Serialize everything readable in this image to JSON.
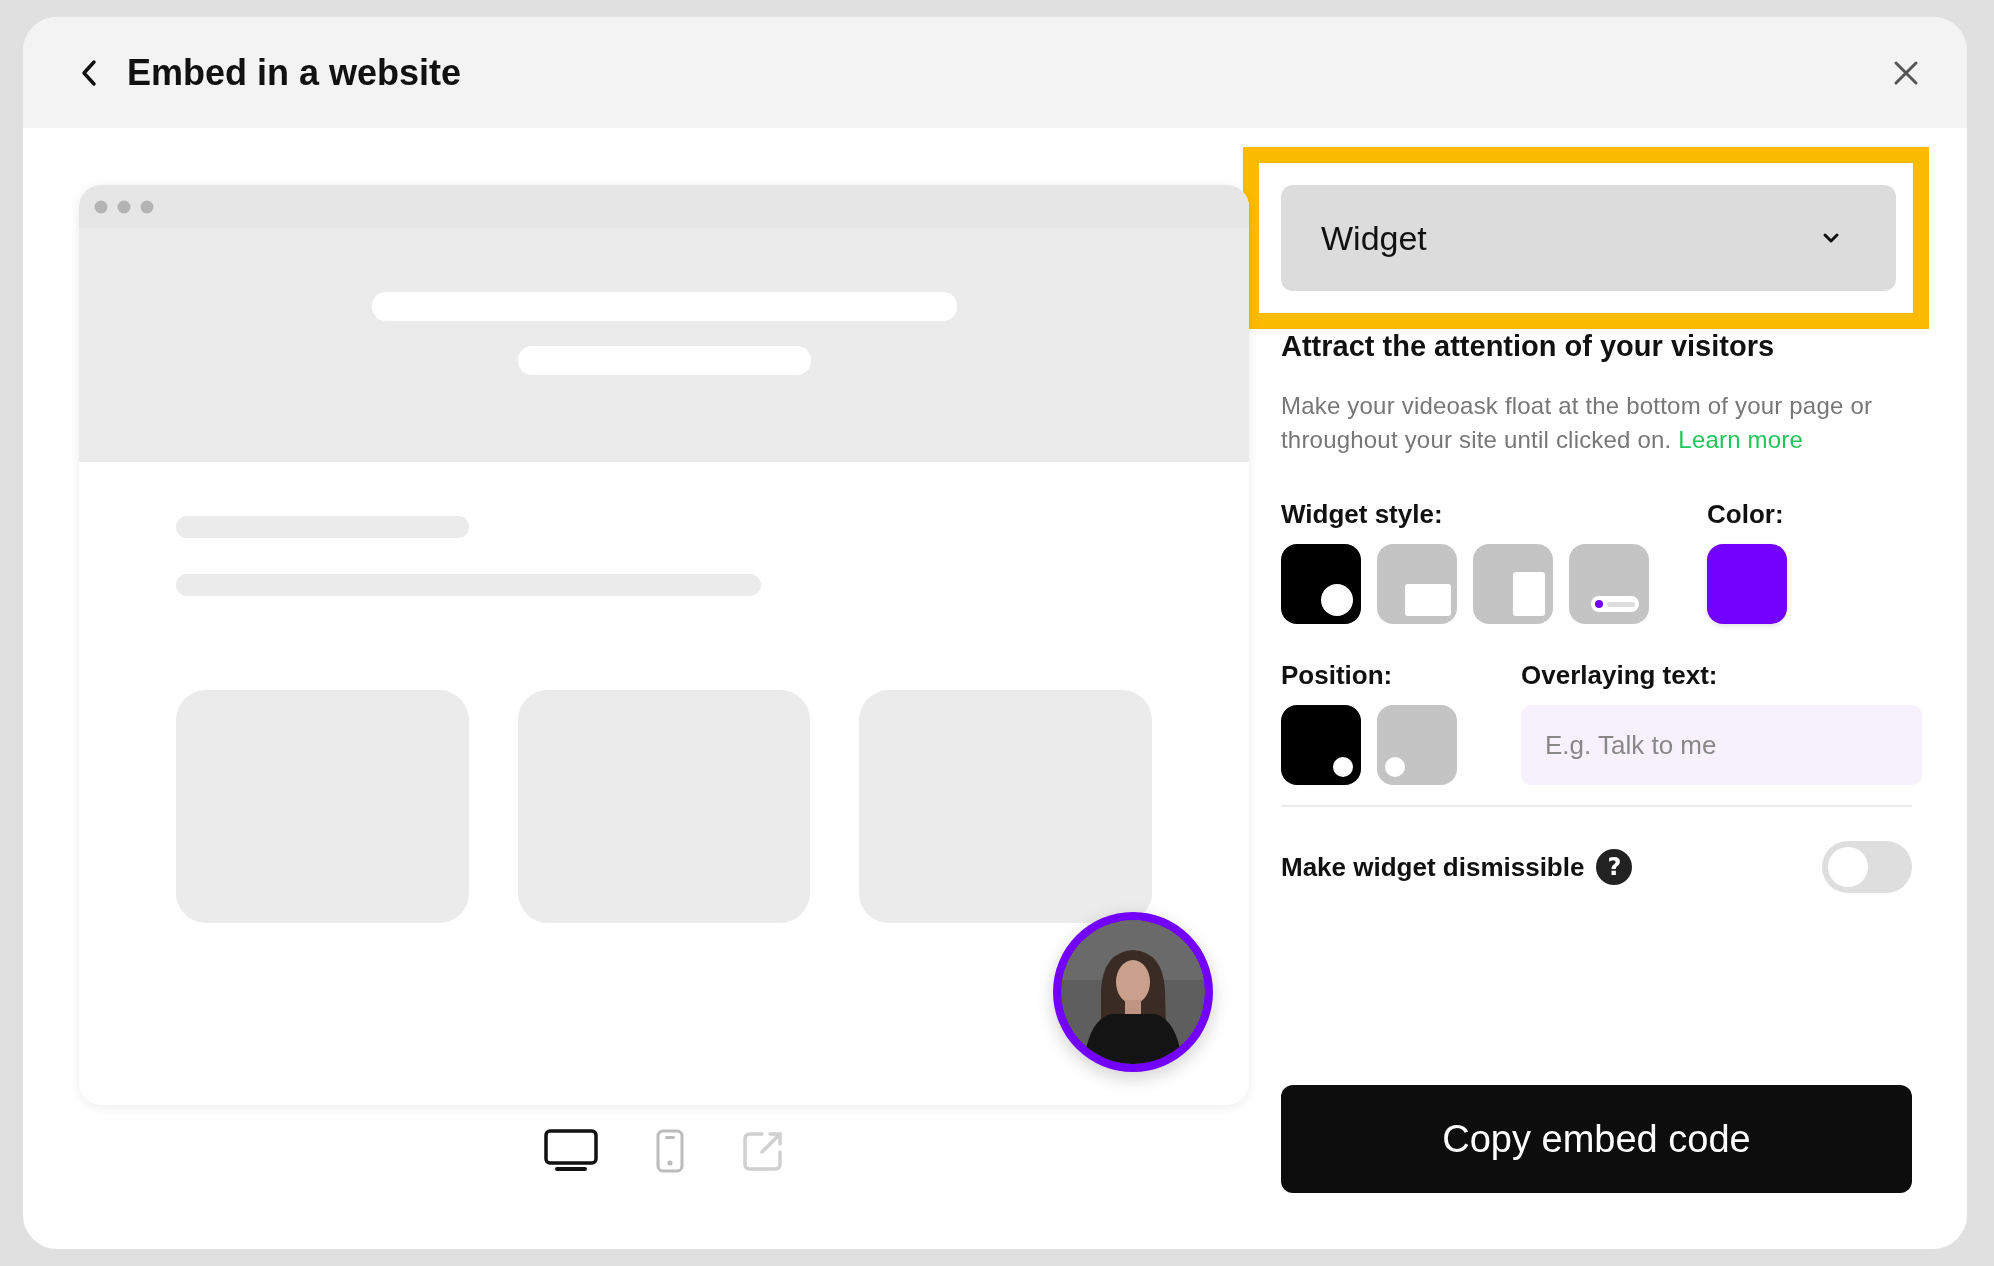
{
  "dialog": {
    "title": "Embed in a website"
  },
  "views": [
    {
      "kind": "desktop",
      "selected": true
    },
    {
      "kind": "mobile",
      "selected": false
    },
    {
      "kind": "external",
      "selected": false
    }
  ],
  "embed_type": {
    "value": "Widget",
    "highlighted": true
  },
  "heading": "Attract the attention of your visitors",
  "description": "Make your videoask float at the bottom of your page or throughout your site until clicked on.",
  "learn_more": "Learn more",
  "widget_style": {
    "label": "Widget style:",
    "options": [
      {
        "kind": "bubble",
        "selected": true
      },
      {
        "kind": "landscape",
        "selected": false
      },
      {
        "kind": "portrait",
        "selected": false
      },
      {
        "kind": "bar",
        "selected": false
      }
    ]
  },
  "color": {
    "label": "Color:",
    "color": "#7300ff"
  },
  "position": {
    "label": "Position:",
    "options": [
      {
        "kind": "right",
        "selected": true
      },
      {
        "kind": "left",
        "selected": false
      }
    ]
  },
  "overlaying_text": {
    "label": "Overlaying text:",
    "placeholder": "E.g. Talk to me"
  },
  "dismissible": {
    "label": "Make widget dismissible",
    "help": "?",
    "on": false
  },
  "copy_button": "Copy embed code"
}
